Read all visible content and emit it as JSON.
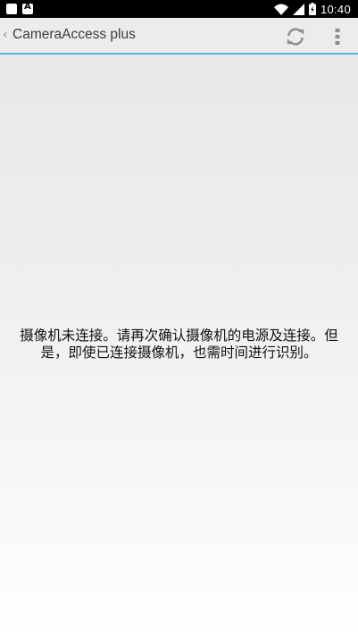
{
  "status_bar": {
    "time": "10:40",
    "left_icons": [
      "notification-square-icon",
      "notification-app-icon"
    ],
    "right_icons": [
      "wifi-icon",
      "cell-signal-icon",
      "battery-icon"
    ]
  },
  "action_bar": {
    "back_icon": "chevron-left-icon",
    "title": "CameraAccess plus",
    "refresh_icon": "refresh-icon",
    "overflow_icon": "more-vertical-icon",
    "accent_color": "#5bb8e4"
  },
  "main": {
    "message": "摄像机未连接。请再次确认摄像机的电源及连接。但是，即使已连接摄像机，也需时间进行识别。"
  }
}
